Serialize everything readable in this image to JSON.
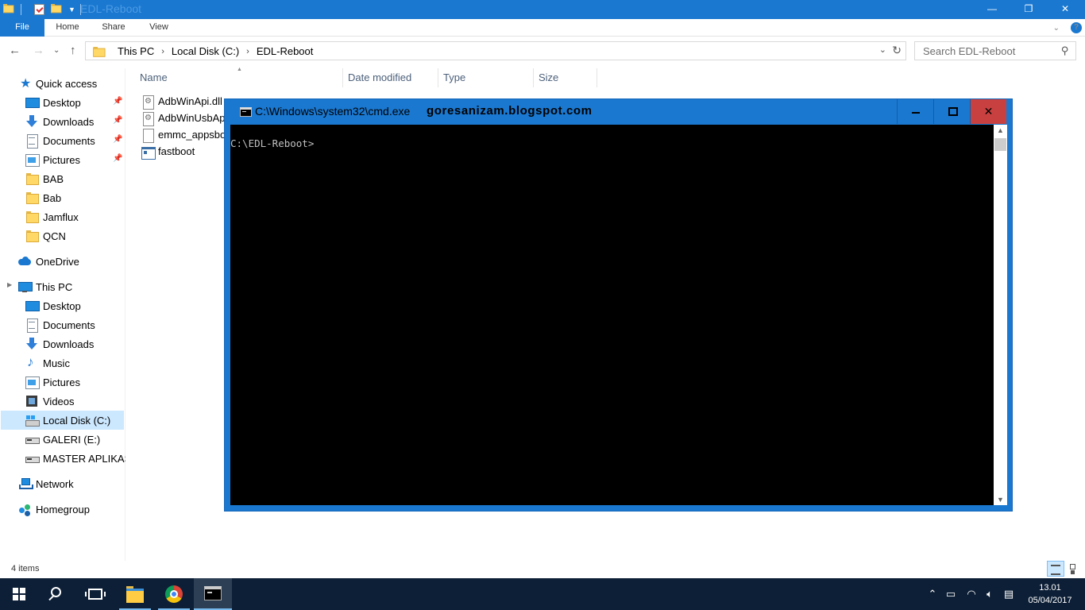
{
  "explorer": {
    "title": "EDL-Reboot",
    "ribbon_tabs": [
      "File",
      "Home",
      "Share",
      "View"
    ],
    "breadcrumb": [
      "This PC",
      "Local Disk (C:)",
      "EDL-Reboot"
    ],
    "search_placeholder": "Search EDL-Reboot",
    "columns": [
      "Name",
      "Date modified",
      "Type",
      "Size"
    ],
    "files": [
      {
        "name": "AdbWinApi.dll",
        "icon": "dll-file-icon"
      },
      {
        "name": "AdbWinUsbAp",
        "icon": "dll-file-icon"
      },
      {
        "name": "emmc_appsbo",
        "icon": "file-icon"
      },
      {
        "name": "fastboot",
        "icon": "exe-file-icon"
      }
    ],
    "status": "4 items",
    "accent_color": "#1a78d0"
  },
  "nav_pane": {
    "quick_access": "Quick access",
    "quick_items": [
      "Desktop",
      "Downloads",
      "Documents",
      "Pictures",
      "BAB",
      "Bab",
      "Jamflux",
      "QCN"
    ],
    "onedrive": "OneDrive",
    "this_pc": "This PC",
    "pc_items": [
      "Desktop",
      "Documents",
      "Downloads",
      "Music",
      "Pictures",
      "Videos",
      "Local Disk (C:)",
      "GALERI (E:)",
      "MASTER APLIKASI"
    ],
    "network": "Network",
    "homegroup": "Homegroup"
  },
  "cmd": {
    "title": "C:\\Windows\\system32\\cmd.exe",
    "watermark": "goresanizam.blogspot.com",
    "prompt": "C:\\EDL-Reboot>",
    "background": "#000000"
  },
  "taskbar": {
    "time": "13.01",
    "date": "05/04/2017",
    "pinned": [
      "start-icon",
      "search-icon",
      "task-view-icon",
      "file-explorer-icon",
      "chrome-icon",
      "cmd-icon"
    ]
  }
}
